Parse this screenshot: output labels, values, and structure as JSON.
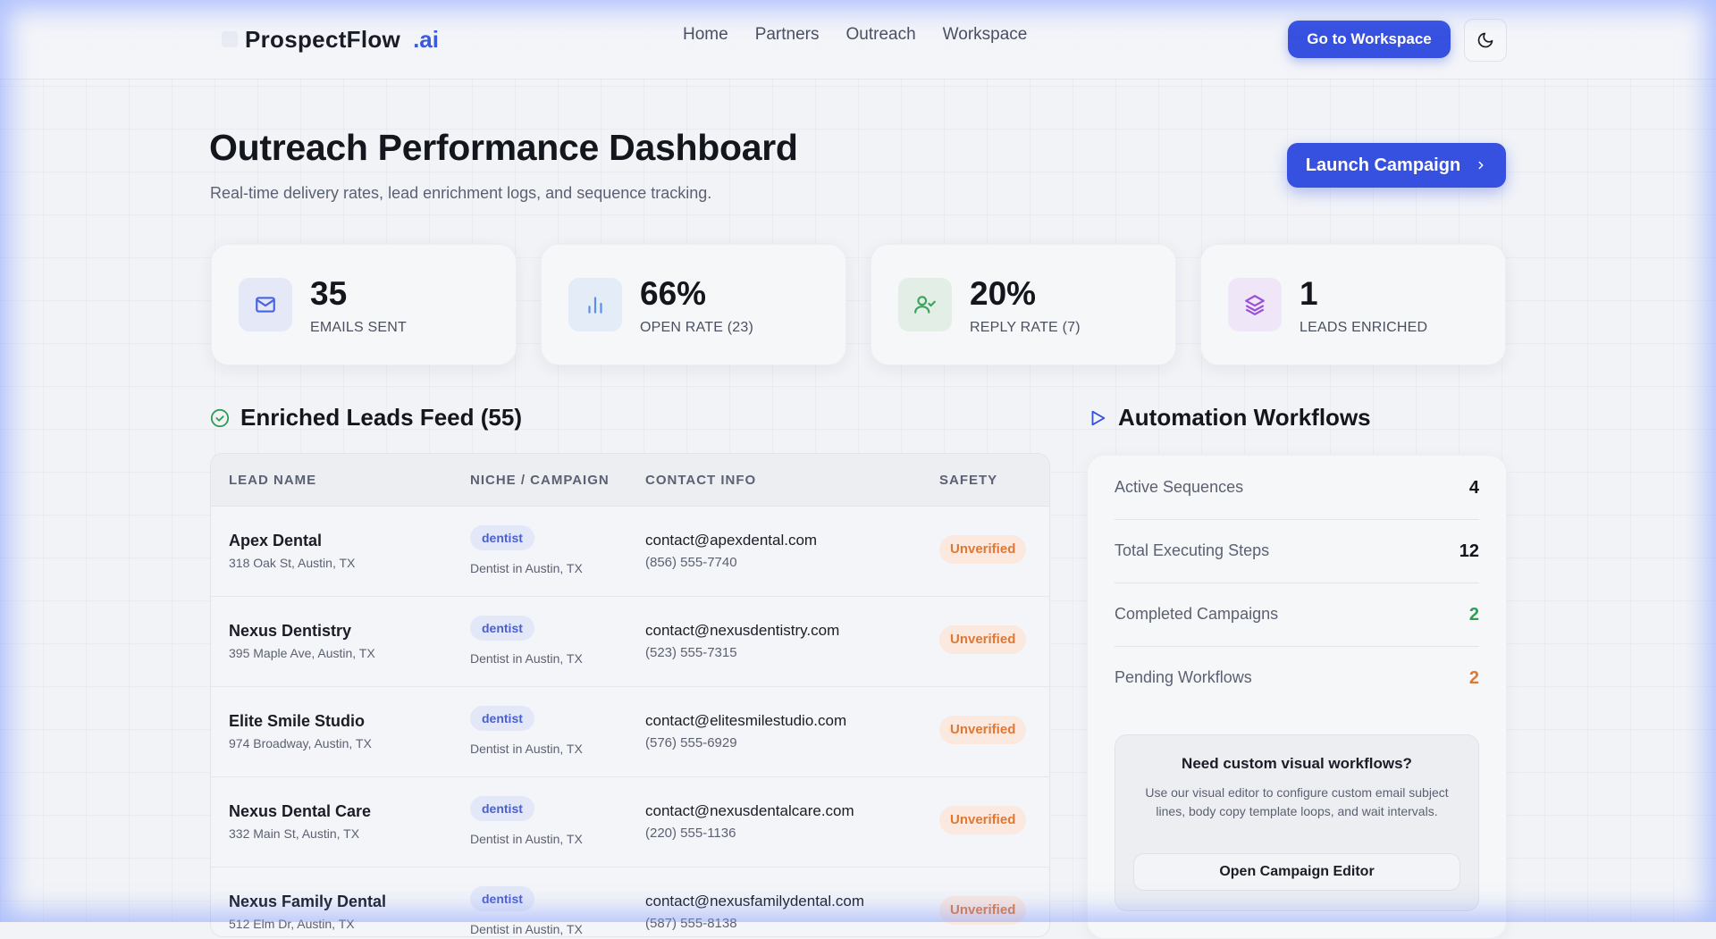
{
  "nav": {
    "brand_name": "ProspectFlow",
    "brand_suffix": ".ai",
    "links": [
      "Home",
      "Partners",
      "Outreach",
      "Workspace"
    ],
    "workspace_button": "Go to Workspace",
    "theme_icon": "moon-icon"
  },
  "header": {
    "title": "Outreach Performance Dashboard",
    "subtitle": "Real-time delivery rates, lead enrichment logs, and sequence tracking.",
    "launch_button": "Launch Campaign"
  },
  "stats": [
    {
      "value": "35",
      "label": "EMAILS SENT",
      "icon": "mail-icon",
      "color": "#4a63e0",
      "bg": "#e4e8f7"
    },
    {
      "value": "66%",
      "label": "OPEN RATE (23)",
      "icon": "bar-chart-icon",
      "color": "#5a8ee8",
      "bg": "#e4ecf7"
    },
    {
      "value": "20%",
      "label": "REPLY RATE (7)",
      "icon": "user-check-icon",
      "color": "#3aa35c",
      "bg": "#e3efe6"
    },
    {
      "value": "1",
      "label": "LEADS ENRICHED",
      "icon": "layers-icon",
      "color": "#9a4fd8",
      "bg": "#efe6f7"
    }
  ],
  "leads": {
    "title": "Enriched Leads Feed (55)",
    "columns": [
      "LEAD NAME",
      "NICHE / CAMPAIGN",
      "CONTACT INFO",
      "SAFETY"
    ],
    "rows": [
      {
        "name": "Apex Dental",
        "address": "318 Oak St, Austin, TX",
        "niche": "dentist",
        "campaign": "Dentist in Austin, TX",
        "email": "contact@apexdental.com",
        "phone": "(856) 555-7740",
        "safety": "Unverified"
      },
      {
        "name": "Nexus Dentistry",
        "address": "395 Maple Ave, Austin, TX",
        "niche": "dentist",
        "campaign": "Dentist in Austin, TX",
        "email": "contact@nexusdentistry.com",
        "phone": "(523) 555-7315",
        "safety": "Unverified"
      },
      {
        "name": "Elite Smile Studio",
        "address": "974 Broadway, Austin, TX",
        "niche": "dentist",
        "campaign": "Dentist in Austin, TX",
        "email": "contact@elitesmilestudio.com",
        "phone": "(576) 555-6929",
        "safety": "Unverified"
      },
      {
        "name": "Nexus Dental Care",
        "address": "332 Main St, Austin, TX",
        "niche": "dentist",
        "campaign": "Dentist in Austin, TX",
        "email": "contact@nexusdentalcare.com",
        "phone": "(220) 555-1136",
        "safety": "Unverified"
      },
      {
        "name": "Nexus Family Dental",
        "address": "512 Elm Dr, Austin, TX",
        "niche": "dentist",
        "campaign": "Dentist in Austin, TX",
        "email": "contact@nexusfamilydental.com",
        "phone": "(587) 555-8138",
        "safety": "Unverified"
      }
    ]
  },
  "automation": {
    "title": "Automation Workflows",
    "metrics": [
      {
        "label": "Active Sequences",
        "value": "4",
        "color": "#14161d"
      },
      {
        "label": "Total Executing Steps",
        "value": "12",
        "color": "#14161d"
      },
      {
        "label": "Completed Campaigns",
        "value": "2",
        "color": "#2f9e55"
      },
      {
        "label": "Pending Workflows",
        "value": "2",
        "color": "#e07835"
      }
    ],
    "custom": {
      "title": "Need custom visual workflows?",
      "description": "Use our visual editor to configure custom email subject lines, body copy template loops, and wait intervals.",
      "button": "Open Campaign Editor"
    }
  }
}
